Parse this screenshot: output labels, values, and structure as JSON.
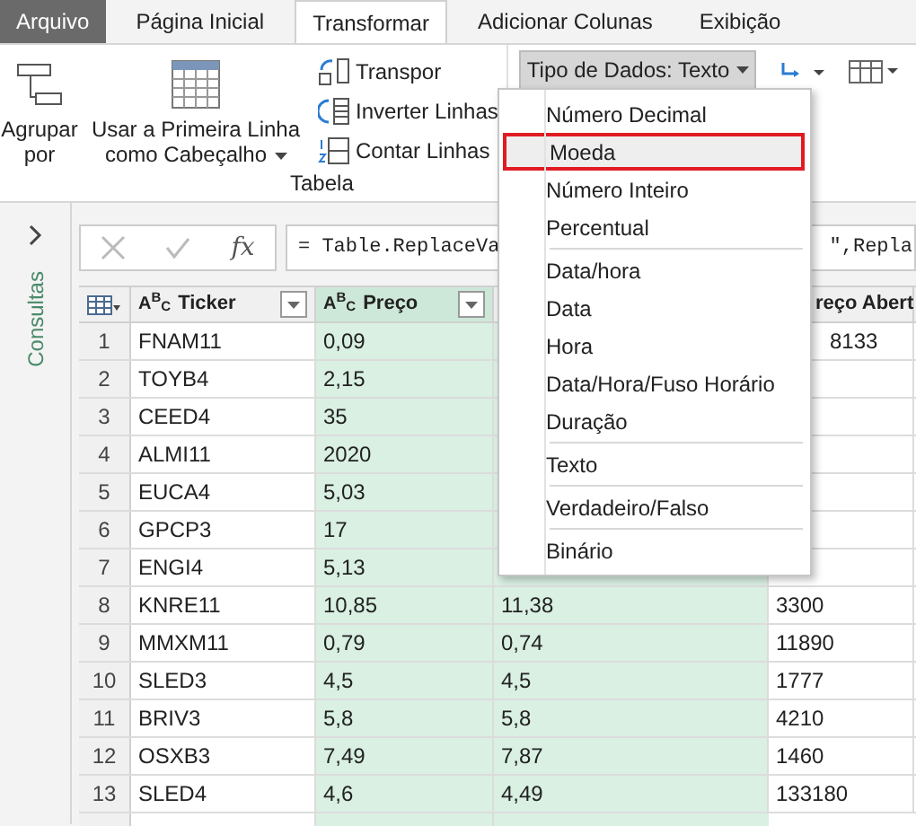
{
  "tabs": [
    {
      "label": "Arquivo",
      "kind": "file",
      "selected": false
    },
    {
      "label": "Página Inicial",
      "kind": "tab",
      "selected": false
    },
    {
      "label": "Transformar",
      "kind": "tab",
      "selected": true
    },
    {
      "label": "Adicionar Colunas",
      "kind": "tab",
      "selected": false
    },
    {
      "label": "Exibição",
      "kind": "tab",
      "selected": false
    }
  ],
  "ribbon": {
    "group_by": "Agrupar por",
    "first_row_header": "Usar a Primeira Linha como Cabeçalho",
    "small_buttons": [
      "Transpor",
      "Inverter Linhas",
      "Contar Linhas"
    ],
    "group_label": "Tabela",
    "data_type_button": "Tipo de Dados: Texto"
  },
  "data_type_menu": [
    {
      "label": "Número Decimal",
      "separator_before": false,
      "selected": false
    },
    {
      "label": "Moeda",
      "separator_before": false,
      "selected": true
    },
    {
      "label": "Número Inteiro",
      "separator_before": false,
      "selected": false
    },
    {
      "label": "Percentual",
      "separator_before": false,
      "selected": false
    },
    {
      "label": "Data/hora",
      "separator_before": true,
      "selected": false
    },
    {
      "label": "Data",
      "separator_before": false,
      "selected": false
    },
    {
      "label": "Hora",
      "separator_before": false,
      "selected": false
    },
    {
      "label": "Data/Hora/Fuso Horário",
      "separator_before": false,
      "selected": false
    },
    {
      "label": "Duração",
      "separator_before": false,
      "selected": false
    },
    {
      "label": "Texto",
      "separator_before": true,
      "selected": false
    },
    {
      "label": "Verdadeiro/Falso",
      "separator_before": true,
      "selected": false
    },
    {
      "label": "Binário",
      "separator_before": true,
      "selected": false
    }
  ],
  "side_panel": {
    "label": "Consultas"
  },
  "formula_bar": {
    "fx": "fx",
    "formula_start": "= Table.ReplaceVa",
    "formula_end": "\",Repla"
  },
  "table": {
    "columns": [
      {
        "title": "Ticker",
        "type_glyph": "A$^{B}$$_{C}$"
      },
      {
        "title": "Preço",
        "type_glyph": "A$^{B}$$_{C}$"
      },
      {},
      {
        "title": "reço Abert"
      }
    ],
    "rows": [
      {
        "number": "1",
        "cells": [
          "FNAM11",
          "0,09",
          "",
          "8133"
        ]
      },
      {
        "number": "2",
        "cells": [
          "TOYB4",
          "2,15",
          "",
          ""
        ]
      },
      {
        "number": "3",
        "cells": [
          "CEED4",
          "35",
          "",
          ""
        ]
      },
      {
        "number": "4",
        "cells": [
          "ALMI11",
          "2020",
          "",
          ""
        ]
      },
      {
        "number": "5",
        "cells": [
          "EUCA4",
          "5,03",
          "",
          ""
        ]
      },
      {
        "number": "6",
        "cells": [
          "GPCP3",
          "17",
          "",
          ""
        ]
      },
      {
        "number": "7",
        "cells": [
          "ENGI4",
          "5,13",
          "",
          ""
        ]
      },
      {
        "number": "8",
        "cells": [
          "KNRE11",
          "10,85",
          "11,38",
          "3300"
        ]
      },
      {
        "number": "9",
        "cells": [
          "MMXM11",
          "0,79",
          "0,74",
          "11890"
        ]
      },
      {
        "number": "10",
        "cells": [
          "SLED3",
          "4,5",
          "4,5",
          "1777"
        ]
      },
      {
        "number": "11",
        "cells": [
          "BRIV3",
          "5,8",
          "5,8",
          "4210"
        ]
      },
      {
        "number": "12",
        "cells": [
          "OSXB3",
          "7,49",
          "7,87",
          "1460"
        ]
      },
      {
        "number": "13",
        "cells": [
          "SLED4",
          "4,6",
          "4,49",
          "133180"
        ]
      }
    ]
  }
}
